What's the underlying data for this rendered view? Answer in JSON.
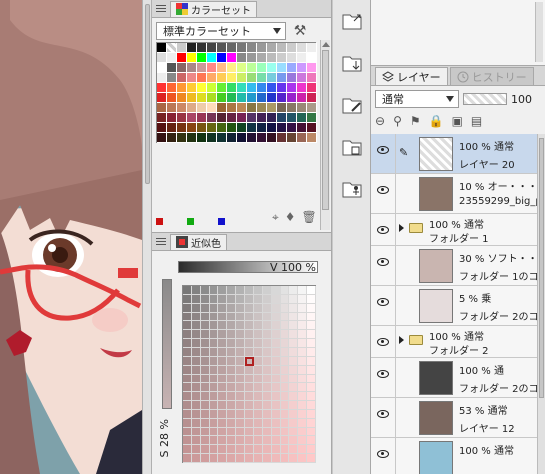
{
  "colorset": {
    "tab_label": "カラーセット",
    "selected_set": "標準カラーセット",
    "main_colors": [
      "#cc1111",
      "#11aa11",
      "#1111cc"
    ],
    "swatches": [
      "#000000",
      "#ffffff",
      "#cccccc",
      "#222222",
      "#333333",
      "#444444",
      "#555555",
      "#666666",
      "#777777",
      "#888888",
      "#999999",
      "#aaaaaa",
      "#bbbbbb",
      "#cccccc",
      "#dddddd",
      "#eeeeee",
      "#dddddd",
      "#eeeeee",
      "#ff0000",
      "#ffff00",
      "#00ff00",
      "#00ffff",
      "#0000ff",
      "#ff00ff",
      "#888888",
      "#999999",
      "#aaaaaa",
      "#bbbbbb",
      "#cccccc",
      "#dddddd",
      "#eeeeee",
      "#ffffff",
      "#ffffff",
      "#555555",
      "#886666",
      "#aa8888",
      "#cc9999",
      "#ff8888",
      "#ffbb88",
      "#ffee88",
      "#ddff88",
      "#bbff99",
      "#99ffbb",
      "#99ffee",
      "#99ddff",
      "#99aaff",
      "#cc99ff",
      "#ff99ee",
      "#eeeeee",
      "#888888",
      "#cc6666",
      "#ee8888",
      "#ff7755",
      "#ffaa66",
      "#ffcc55",
      "#ffee66",
      "#ccee66",
      "#99dd77",
      "#77ddaa",
      "#77ccdd",
      "#7799ee",
      "#9977dd",
      "#cc77dd",
      "#ee77bb",
      "#ff3333",
      "#ff6633",
      "#ff9933",
      "#ffcc33",
      "#ffff33",
      "#ccff33",
      "#66ee33",
      "#33dd66",
      "#33ddbb",
      "#33bbee",
      "#3388ee",
      "#3355ee",
      "#6633ee",
      "#aa33ee",
      "#ee33cc",
      "#ee3377",
      "#dd2222",
      "#ee5522",
      "#ee8822",
      "#eebb22",
      "#dddd22",
      "#aadd22",
      "#44cc22",
      "#22bb55",
      "#22bbaa",
      "#2299cc",
      "#2266cc",
      "#2233cc",
      "#5522cc",
      "#9922cc",
      "#cc22aa",
      "#cc2255",
      "#aa6644",
      "#bb7755",
      "#cc8866",
      "#ddaa88",
      "#eeccaa",
      "#ffddbb",
      "#996633",
      "#aa7744",
      "#bb8855",
      "#887744",
      "#998855",
      "#aa9966",
      "#776655",
      "#887766",
      "#998877",
      "#aa9988",
      "#772222",
      "#882233",
      "#993344",
      "#aa4466",
      "#993355",
      "#773355",
      "#552233",
      "#662244",
      "#772255",
      "#553366",
      "#442255",
      "#332255",
      "#224466",
      "#225566",
      "#226655",
      "#337744",
      "#551111",
      "#662211",
      "#773311",
      "#884411",
      "#775511",
      "#666611",
      "#446611",
      "#225511",
      "#114422",
      "#113344",
      "#112244",
      "#111144",
      "#221144",
      "#331144",
      "#441133",
      "#551122",
      "#331111",
      "#332211",
      "#333311",
      "#223311",
      "#113311",
      "#113322",
      "#113333",
      "#112233",
      "#111133",
      "#221133",
      "#331133",
      "#331122",
      "#663333",
      "#664433",
      "#996655",
      "#bb8866"
    ],
    "tools": [
      "eyedropper-icon",
      "fill-icon",
      "trash-icon"
    ]
  },
  "similar": {
    "tab_label": "近似色",
    "v_label": "V",
    "v_value": "100 %",
    "s_label": "S",
    "s_value": "28 %"
  },
  "layers": {
    "tab_label": "レイヤー",
    "history_tab_label": "ヒストリー",
    "blend_mode": "通常",
    "opacity": "100",
    "rows": [
      {
        "type": "layer",
        "line1": "100 % 通常",
        "line2": "レイヤー 20",
        "thumb": "#ffffff",
        "selected": true,
        "pencil": true
      },
      {
        "type": "layer",
        "line1": "10 % オー・・・",
        "line2": "23559299_big_p",
        "thumb": "#8a7468",
        "selected": false,
        "pencil": false
      },
      {
        "type": "folder",
        "line1": "100 % 通常",
        "line2": "フォルダー 1",
        "selected": false
      },
      {
        "type": "layer",
        "line1": "30 % ソフト・・・",
        "line2": "フォルダー 1のコ",
        "thumb": "#c9b5b0",
        "selected": false,
        "pencil": false
      },
      {
        "type": "layer",
        "line1": "5 % 乗",
        "line2": "フォルダー 2のコ",
        "thumb": "#e5dcdc",
        "selected": false,
        "pencil": false
      },
      {
        "type": "folder",
        "line1": "100 % 通常",
        "line2": "フォルダー 2",
        "selected": false
      },
      {
        "type": "layer",
        "line1": "100 % 通",
        "line2": "フォルダー 2のコ",
        "thumb": "#444444",
        "selected": false,
        "pencil": false
      },
      {
        "type": "layer",
        "line1": "53 % 通常",
        "line2": "レイヤー 12",
        "thumb": "#7a665e",
        "selected": false,
        "pencil": false
      },
      {
        "type": "layer",
        "line1": "100 % 通常",
        "line2": "",
        "thumb": "#8fc0d6",
        "selected": false,
        "pencil": false
      }
    ]
  },
  "midbar": {
    "buttons": [
      "expand-icon",
      "layer-import-icon",
      "layer-edit-icon",
      "layer-3d-icon",
      "layer-person-icon"
    ]
  }
}
